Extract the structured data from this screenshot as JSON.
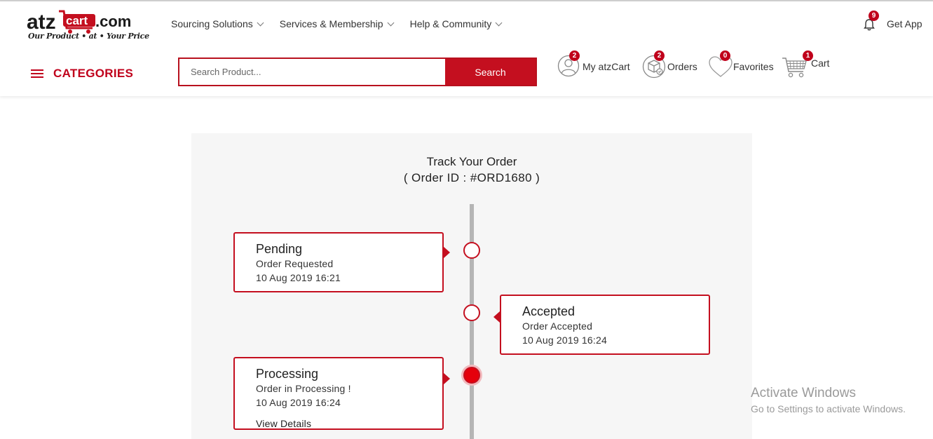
{
  "brand": {
    "logo_atz": "atz",
    "logo_cart": "cart",
    "logo_com": ".com",
    "tagline": "Our Product • at • Your Price",
    "primary_color": "#c40f1f"
  },
  "nav": {
    "items": [
      {
        "label": "Sourcing Solutions"
      },
      {
        "label": "Services & Membership"
      },
      {
        "label": "Help & Community"
      }
    ]
  },
  "notifications": {
    "count": "9",
    "icon": "bell-icon"
  },
  "get_app_label": "Get App",
  "categories_label": "CATEGORIES",
  "search": {
    "placeholder": "Search Product...",
    "value": "",
    "button_label": "Search"
  },
  "header_icons": {
    "my_account": {
      "label": "My atzCart",
      "badge": "2",
      "icon": "user-icon"
    },
    "orders": {
      "label": "Orders",
      "badge": "2",
      "icon": "box-icon"
    },
    "favorites": {
      "label": "Favorites",
      "badge": "0",
      "icon": "heart-icon"
    },
    "cart": {
      "label": "Cart",
      "badge": "1",
      "icon": "cart-icon"
    }
  },
  "tracking": {
    "title": "Track Your Order",
    "order_id_line": "( Order ID : #ORD1680 )",
    "steps": [
      {
        "status": "Pending",
        "description": "Order Requested",
        "date": "10 Aug 2019 16:21",
        "side": "left",
        "active": false
      },
      {
        "status": "Accepted",
        "description": "Order Accepted",
        "date": "10 Aug 2019 16:24",
        "side": "right",
        "active": false
      },
      {
        "status": "Processing",
        "description": "Order in Processing !",
        "date": "10 Aug 2019 16:24",
        "side": "left",
        "active": true,
        "link_label": "View Details"
      }
    ]
  },
  "watermark": {
    "line1": "Activate Windows",
    "line2": "Go to Settings to activate Windows."
  }
}
